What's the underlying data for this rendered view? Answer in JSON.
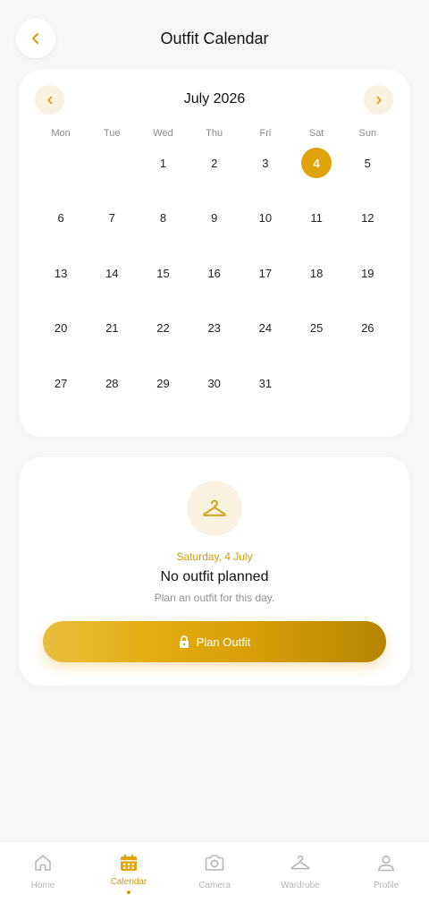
{
  "header": {
    "title": "Outfit Calendar"
  },
  "calendar": {
    "month_label": "July 2026",
    "weekdays": [
      "Mon",
      "Tue",
      "Wed",
      "Thu",
      "Fri",
      "Sat",
      "Sun"
    ],
    "first_weekday_index": 2,
    "days_in_month": 31,
    "selected_day": 4
  },
  "selection": {
    "date_label": "Saturday, 4 July",
    "status": "No outfit planned",
    "hint": "Plan an outfit for this day.",
    "button_label": "Plan Outfit"
  },
  "tabs": [
    {
      "label": "Home",
      "icon": "home-icon",
      "active": false
    },
    {
      "label": "Calendar",
      "icon": "calendar-icon",
      "active": true
    },
    {
      "label": "Camera",
      "icon": "camera-icon",
      "active": false
    },
    {
      "label": "Wardrobe",
      "icon": "hanger-icon",
      "active": false
    },
    {
      "label": "Profile",
      "icon": "profile-icon",
      "active": false
    }
  ],
  "colors": {
    "accent": "#e0a30c",
    "accent_light": "#faf2e1",
    "background": "#f7f7f7"
  }
}
